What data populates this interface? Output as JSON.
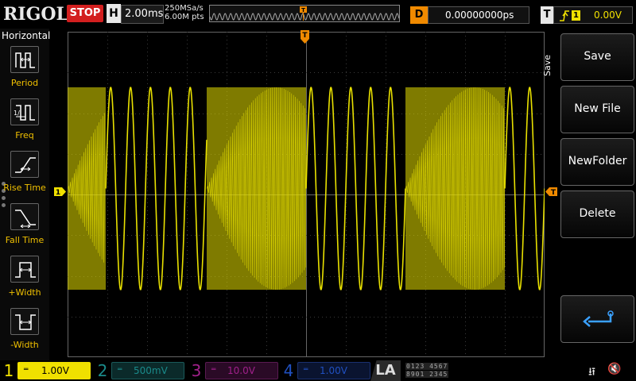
{
  "topbar": {
    "logo": "RIGOL",
    "run_state": "STOP",
    "horizontal_key": "H",
    "timebase": "2.00ms",
    "sample_rate": "250MSa/s",
    "memory_depth": "6.00M pts",
    "trigger_marker": "T",
    "delay_key": "D",
    "delay_value": "0.00000000ps",
    "trigger_key": "T",
    "trigger_source": "1",
    "trigger_level": "0.00V"
  },
  "left_menu": {
    "title": "Horizontal",
    "items": [
      {
        "label": "Period",
        "icon": "period-measure-icon"
      },
      {
        "label": "Freq",
        "icon": "frequency-measure-icon"
      },
      {
        "label": "Rise Time",
        "icon": "rise-time-icon"
      },
      {
        "label": "Fall Time",
        "icon": "fall-time-icon"
      },
      {
        "label": "+Width",
        "icon": "positive-width-icon"
      },
      {
        "label": "-Width",
        "icon": "negative-width-icon"
      }
    ]
  },
  "screen": {
    "trigger_position_marker": "T",
    "channel1_offset_marker": "1",
    "trigger_level_marker": "T",
    "trace_color": "#e8e000",
    "grid_color": "#3a3a3a",
    "signal": "FSK-like alternating bursts of high-frequency and low-frequency sine wave"
  },
  "right_menu": {
    "title": "Save",
    "buttons": [
      "Save",
      "New File",
      "NewFolder",
      "Delete"
    ],
    "back_icon": "return-arrow-icon"
  },
  "bottombar": {
    "channels": [
      {
        "num": "1",
        "scale": "1.00V",
        "color": "#f0e000",
        "active": true
      },
      {
        "num": "2",
        "scale": "500mV",
        "color": "#1a8a8a",
        "active": false
      },
      {
        "num": "3",
        "scale": "10.0V",
        "color": "#a0208a",
        "active": false
      },
      {
        "num": "4",
        "scale": "1.00V",
        "color": "#2050c0",
        "active": false
      }
    ],
    "la_label": "LA",
    "la_row1": "0123 4567",
    "la_row2": "8901 2345",
    "usb_icon": "usb-icon",
    "sound_icon": "speaker-muted-icon"
  }
}
